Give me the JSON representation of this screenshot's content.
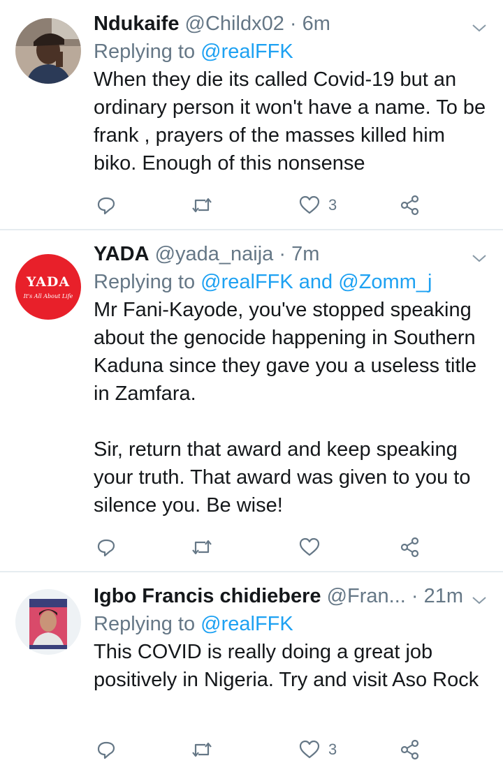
{
  "tweets": [
    {
      "name": "Ndukaife",
      "handle": "@Childx02",
      "separator": "·",
      "time": "6m",
      "reply_prefix": "Replying to",
      "mentions": [
        "@realFFK"
      ],
      "reply_joiner": "",
      "text": "When they die its called Covid-19 but an ordinary person it won't have a name. To be frank , prayers of the masses killed him biko. Enough of this nonsense",
      "like_count": "3"
    },
    {
      "name": "YADA",
      "handle": "@yada_naija",
      "separator": "·",
      "time": "7m",
      "reply_prefix": "Replying to",
      "mentions": [
        "@realFFK",
        "@Zomm_j"
      ],
      "reply_joiner": "and",
      "avatar_title": "YADA",
      "avatar_tagline": "It's All About Life",
      "text": "Mr Fani-Kayode, you've stopped speaking about the genocide happening in Southern Kaduna since they gave you a useless title in Zamfara.\n\nSir, return that award and keep speaking your truth. That award was given to you to silence you. Be wise!",
      "like_count": ""
    },
    {
      "name": "Igbo Francis chidiebere",
      "handle": "@Fran...",
      "separator": "·",
      "time": "21m",
      "reply_prefix": "Replying to",
      "mentions": [
        "@realFFK"
      ],
      "reply_joiner": "",
      "text": "This COVID is really doing a great job positively in Nigeria. Try and visit Aso Rock",
      "like_count": "3"
    }
  ],
  "icons": {
    "reply": "reply-icon",
    "retweet": "retweet-icon",
    "like": "heart-icon",
    "share": "share-icon",
    "menu": "chevron-down-icon"
  },
  "colors": {
    "name": "#14171a",
    "secondary": "#657786",
    "link": "#1da1f2",
    "divider": "#e6ecf0",
    "yada_red": "#e8202a"
  }
}
